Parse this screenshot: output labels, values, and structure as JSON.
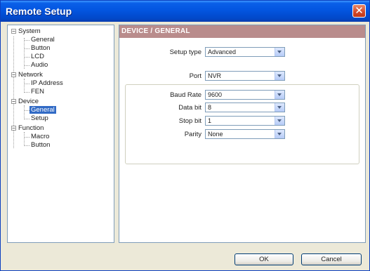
{
  "window": {
    "title": "Remote Setup",
    "close_symbol": "✕"
  },
  "tree": {
    "items": [
      {
        "label": "System",
        "expander": "−"
      },
      {
        "label": "General"
      },
      {
        "label": "Button"
      },
      {
        "label": "LCD"
      },
      {
        "label": "Audio"
      },
      {
        "label": "Network",
        "expander": "−"
      },
      {
        "label": "IP Address"
      },
      {
        "label": "FEN"
      },
      {
        "label": "Device",
        "expander": "−"
      },
      {
        "label": "General",
        "selected": true
      },
      {
        "label": "Setup"
      },
      {
        "label": "Function",
        "expander": "−"
      },
      {
        "label": "Macro"
      },
      {
        "label": "Button"
      }
    ]
  },
  "content": {
    "section_title": "DEVICE / GENERAL",
    "fields": {
      "setup_type": {
        "label": "Setup type",
        "value": "Advanced"
      },
      "port": {
        "label": "Port",
        "value": "NVR"
      },
      "baud_rate": {
        "label": "Baud Rate",
        "value": "9600"
      },
      "data_bit": {
        "label": "Data bit",
        "value": "8"
      },
      "stop_bit": {
        "label": "Stop bit",
        "value": "1"
      },
      "parity": {
        "label": "Parity",
        "value": "None"
      }
    }
  },
  "buttons": {
    "ok": "OK",
    "cancel": "Cancel"
  },
  "colors": {
    "titlebar": "#0355e0",
    "section_header": "#b98c8c",
    "selection": "#316ac5"
  }
}
